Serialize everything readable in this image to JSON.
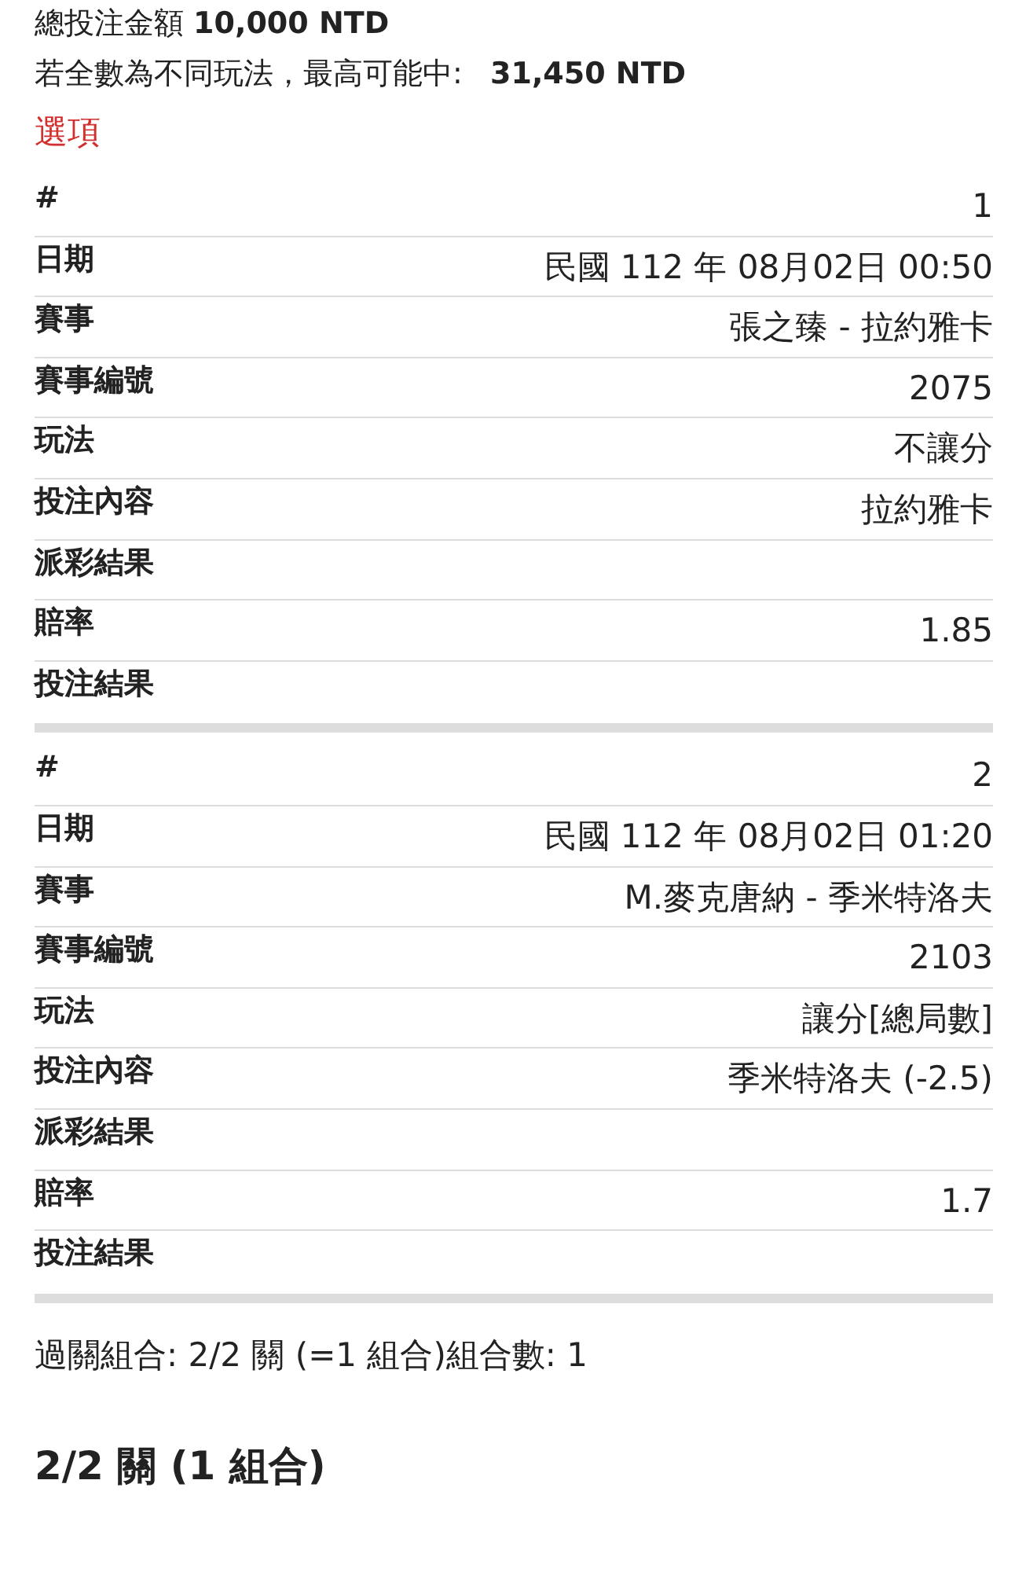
{
  "summary": {
    "total_stake": "總投注金額 **10,000 NTD**",
    "max_payout_label": "若全數為不同玩法，最高可能中:",
    "max_payout_value": "31,450 NTD"
  },
  "options_heading": "選項",
  "bets": [
    {
      "rows": [
        {
          "label": "#",
          "value": "1"
        },
        {
          "label": "日期",
          "value": "民國 112 年 08月02日 00:50"
        },
        {
          "label": "賽事",
          "value": "張之臻 - 拉約雅卡"
        },
        {
          "label": "賽事編號",
          "value": "2075"
        },
        {
          "label": "玩法",
          "value": "不讓分"
        },
        {
          "label": "投注內容",
          "value": "拉約雅卡"
        },
        {
          "label": "派彩結果"
        },
        {
          "label": "賠率",
          "value": "1.85"
        },
        {
          "label": "投注結果"
        }
      ]
    },
    {
      "rows": [
        {
          "label": "#",
          "value": "2"
        },
        {
          "label": "日期",
          "value": "民國 112 年 08月02日 01:20"
        },
        {
          "label": "賽事",
          "value": "M.麥克唐納 - 季米特洛夫"
        },
        {
          "label": "賽事編號",
          "value": "2103"
        },
        {
          "label": "玩法",
          "value": "讓分[總局數]"
        },
        {
          "label": "投注內容",
          "value": "季米特洛夫 (-2.5)"
        },
        {
          "label": "派彩結果"
        },
        {
          "label": "賠率",
          "value": "1.7"
        },
        {
          "label": "投注結果"
        }
      ]
    }
  ],
  "parlay_summary": "過關組合: 2/2 關 (=1 組合)組合數: 1",
  "parlay_heading": "2/2 關 (1 組合)"
}
